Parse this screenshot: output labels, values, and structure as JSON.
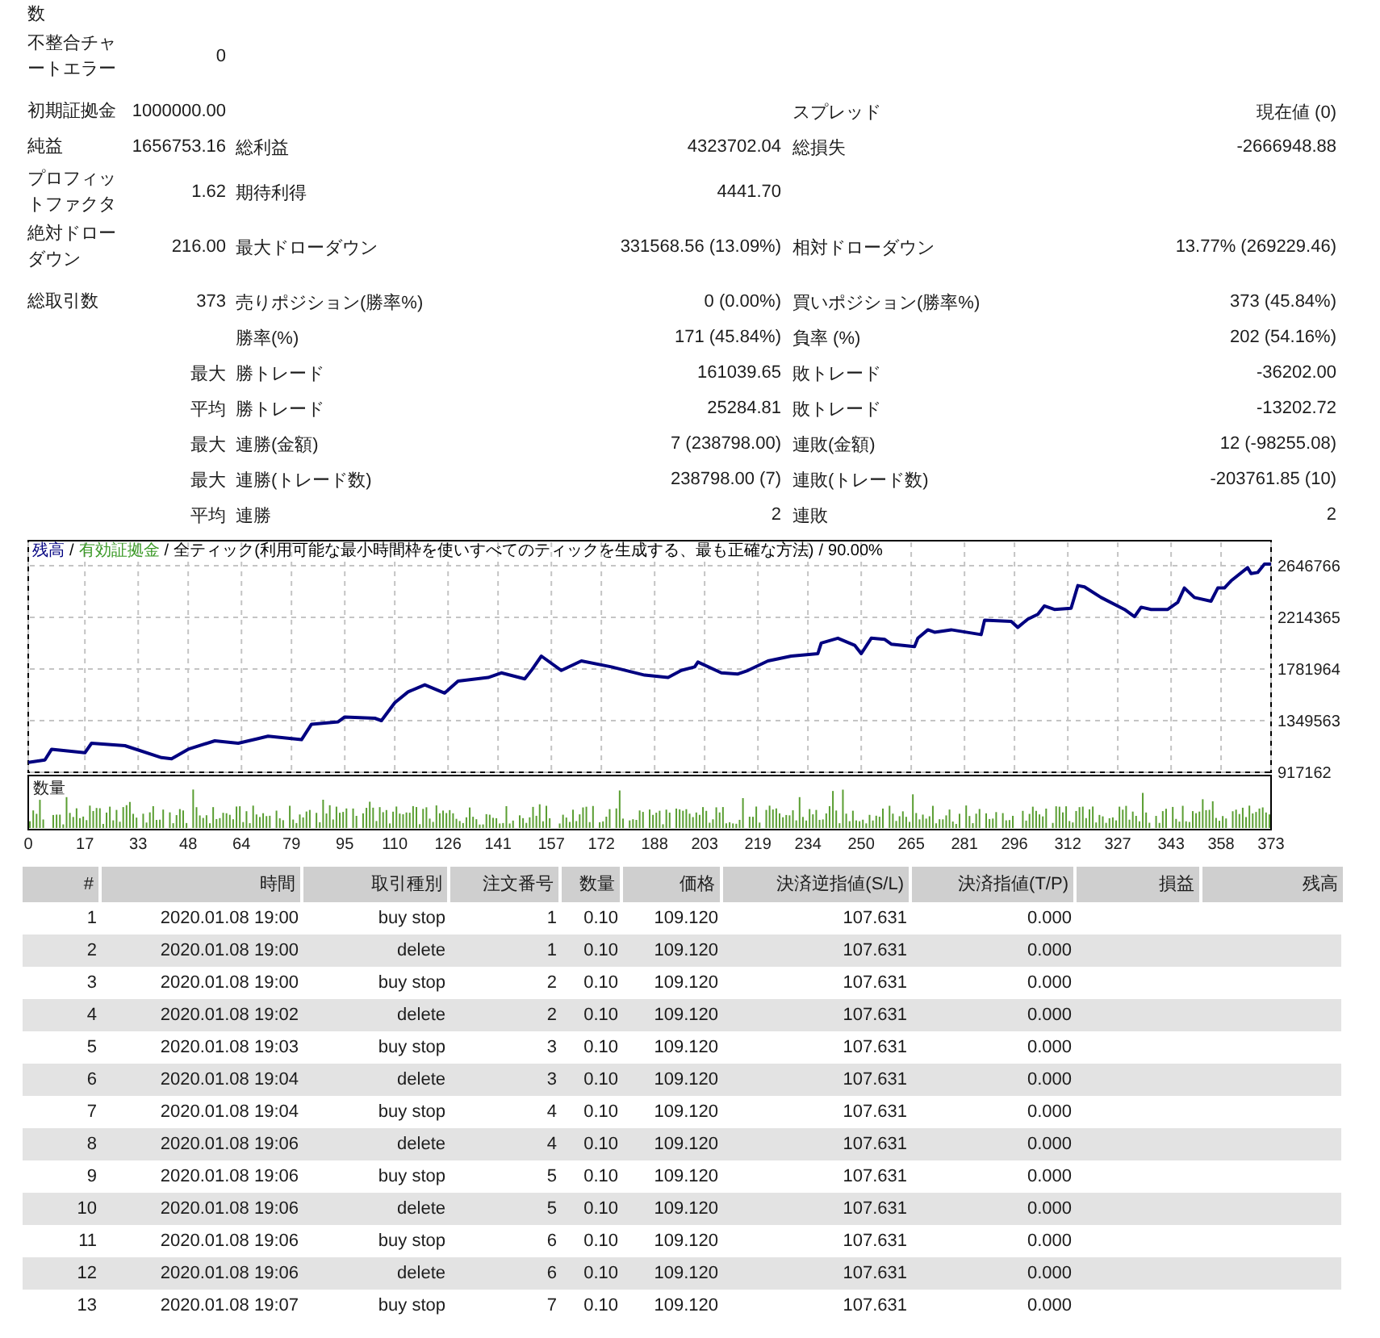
{
  "summary": {
    "sections": [
      {
        "rows": [
          {
            "label": "数"
          },
          {
            "label": "不整合チャートエラー",
            "value": "0"
          }
        ]
      },
      {
        "rows": [
          {
            "label": "初期証拠金",
            "value": "1000000.00",
            "right": {
              "label": "スプレッド",
              "value": "現在値 (0)"
            }
          },
          {
            "label": "純益",
            "value": "1656753.16",
            "middle": {
              "label": "総利益",
              "value": "4323702.04"
            },
            "right": {
              "label": "総損失",
              "value": "-2666948.88"
            }
          },
          {
            "label": "プロフィットファクタ",
            "value": "1.62",
            "middle": {
              "label": "期待利得",
              "value": "4441.70"
            }
          },
          {
            "label": "絶対ドローダウン",
            "value": "216.00",
            "middle": {
              "label": "最大ドローダウン",
              "value": "331568.56 (13.09%)"
            },
            "right": {
              "label": "相対ドローダウン",
              "value": "13.77% (269229.46)"
            }
          }
        ]
      },
      {
        "rows": [
          {
            "label": "総取引数",
            "value": "373",
            "middle": {
              "label": "売りポジション(勝率%)",
              "value": "0 (0.00%)"
            },
            "right": {
              "label": "買いポジション(勝率%)",
              "value": "373 (45.84%)"
            }
          },
          {
            "middle": {
              "label": "勝率(%)",
              "value": "171 (45.84%)"
            },
            "right": {
              "label": "負率 (%)",
              "value": "202 (54.16%)"
            }
          },
          {
            "qualifier": "最大",
            "middle": {
              "label": "勝トレード",
              "value": "161039.65"
            },
            "right": {
              "label": "敗トレード",
              "value": "-36202.00"
            }
          },
          {
            "qualifier": "平均",
            "middle": {
              "label": "勝トレード",
              "value": "25284.81"
            },
            "right": {
              "label": "敗トレード",
              "value": "-13202.72"
            }
          },
          {
            "qualifier": "最大",
            "middle": {
              "label": "連勝(金額)",
              "value": "7 (238798.00)"
            },
            "right": {
              "label": "連敗(金額)",
              "value": "12 (-98255.08)"
            }
          },
          {
            "qualifier": "最大",
            "middle": {
              "label": "連勝(トレード数)",
              "value": "238798.00 (7)"
            },
            "right": {
              "label": "連敗(トレード数)",
              "value": "-203761.85 (10)"
            }
          },
          {
            "qualifier": "平均",
            "middle": {
              "label": "連勝",
              "value": "2"
            },
            "right": {
              "label": "連敗",
              "value": "2"
            }
          }
        ]
      }
    ]
  },
  "chart": {
    "legend_separator": "/",
    "legend": [
      {
        "text": "有効証拠金",
        "color": "#3c9a28"
      },
      {
        "text": "全ティック(利用可能な最小時間枠を使いすべてのティックを生成する、最も正確な方法)"
      },
      {
        "text": "90.00%"
      }
    ],
    "volume_panel": {
      "label": "数量"
    },
    "chart_data": {
      "type": "line",
      "grid": true,
      "x": [
        0,
        5,
        7,
        17,
        19,
        29,
        40,
        43,
        48,
        56,
        63,
        69,
        72,
        82,
        85,
        93,
        95,
        104,
        106,
        110,
        114,
        119,
        125,
        129,
        138,
        142,
        149,
        151,
        154,
        160,
        166,
        175,
        185,
        192,
        196,
        200,
        201,
        208,
        213,
        216,
        222,
        229,
        237,
        238,
        243,
        248,
        250,
        253,
        257,
        259,
        266,
        267,
        270,
        272,
        277,
        286,
        287,
        295,
        297,
        300,
        303,
        305,
        308,
        313,
        315,
        317,
        322,
        329,
        332,
        334,
        337,
        342,
        345,
        347,
        350,
        355,
        357,
        359,
        361,
        366,
        367,
        369,
        371,
        373
      ],
      "series": [
        {
          "name": "残高",
          "color": "#000080",
          "values": [
            1000000,
            1020000,
            1110000,
            1080000,
            1160000,
            1140000,
            1040000,
            1030000,
            1110000,
            1180000,
            1160000,
            1200000,
            1220000,
            1190000,
            1320000,
            1340000,
            1380000,
            1370000,
            1350000,
            1500000,
            1590000,
            1650000,
            1580000,
            1680000,
            1710000,
            1750000,
            1700000,
            1770000,
            1890000,
            1770000,
            1850000,
            1800000,
            1730000,
            1710000,
            1770000,
            1800000,
            1840000,
            1750000,
            1740000,
            1770000,
            1850000,
            1890000,
            1910000,
            2000000,
            2040000,
            1980000,
            1910000,
            2040000,
            2030000,
            1990000,
            1970000,
            2040000,
            2110000,
            2090000,
            2110000,
            2070000,
            2190000,
            2180000,
            2130000,
            2200000,
            2240000,
            2310000,
            2280000,
            2290000,
            2480000,
            2470000,
            2380000,
            2280000,
            2220000,
            2300000,
            2280000,
            2280000,
            2340000,
            2460000,
            2380000,
            2350000,
            2460000,
            2460000,
            2520000,
            2630000,
            2580000,
            2590000,
            2660000,
            2660000
          ]
        }
      ],
      "xlim": [
        0,
        373
      ],
      "ylim": [
        917162,
        2856000
      ],
      "xticks": [
        0,
        17,
        33,
        48,
        64,
        79,
        95,
        110,
        126,
        141,
        157,
        172,
        188,
        203,
        219,
        234,
        250,
        265,
        281,
        296,
        312,
        327,
        343,
        358,
        373
      ],
      "yticks": [
        917162,
        1349563,
        1781964,
        2214365,
        2646766
      ]
    }
  },
  "table": {
    "columns": [
      "#",
      "時間",
      "取引種別",
      "注文番号",
      "数量",
      "価格",
      "決済逆指値(S/L)",
      "決済指値(T/P)",
      "損益",
      "残高"
    ],
    "rows": [
      [
        "1",
        "2020.01.08 19:00",
        "buy stop",
        "1",
        "0.10",
        "109.120",
        "107.631",
        "0.000"
      ],
      [
        "2",
        "2020.01.08 19:00",
        "delete",
        "1",
        "0.10",
        "109.120",
        "107.631",
        "0.000"
      ],
      [
        "3",
        "2020.01.08 19:00",
        "buy stop",
        "2",
        "0.10",
        "109.120",
        "107.631",
        "0.000"
      ],
      [
        "4",
        "2020.01.08 19:02",
        "delete",
        "2",
        "0.10",
        "109.120",
        "107.631",
        "0.000"
      ],
      [
        "5",
        "2020.01.08 19:03",
        "buy stop",
        "3",
        "0.10",
        "109.120",
        "107.631",
        "0.000"
      ],
      [
        "6",
        "2020.01.08 19:04",
        "delete",
        "3",
        "0.10",
        "109.120",
        "107.631",
        "0.000"
      ],
      [
        "7",
        "2020.01.08 19:04",
        "buy stop",
        "4",
        "0.10",
        "109.120",
        "107.631",
        "0.000"
      ],
      [
        "8",
        "2020.01.08 19:06",
        "delete",
        "4",
        "0.10",
        "109.120",
        "107.631",
        "0.000"
      ],
      [
        "9",
        "2020.01.08 19:06",
        "buy stop",
        "5",
        "0.10",
        "109.120",
        "107.631",
        "0.000"
      ],
      [
        "10",
        "2020.01.08 19:06",
        "delete",
        "5",
        "0.10",
        "109.120",
        "107.631",
        "0.000"
      ],
      [
        "11",
        "2020.01.08 19:06",
        "buy stop",
        "6",
        "0.10",
        "109.120",
        "107.631",
        "0.000"
      ],
      [
        "12",
        "2020.01.08 19:06",
        "delete",
        "6",
        "0.10",
        "109.120",
        "107.631",
        "0.000"
      ],
      [
        "13",
        "2020.01.08 19:07",
        "buy stop",
        "7",
        "0.10",
        "109.120",
        "107.631",
        "0.000"
      ]
    ]
  }
}
